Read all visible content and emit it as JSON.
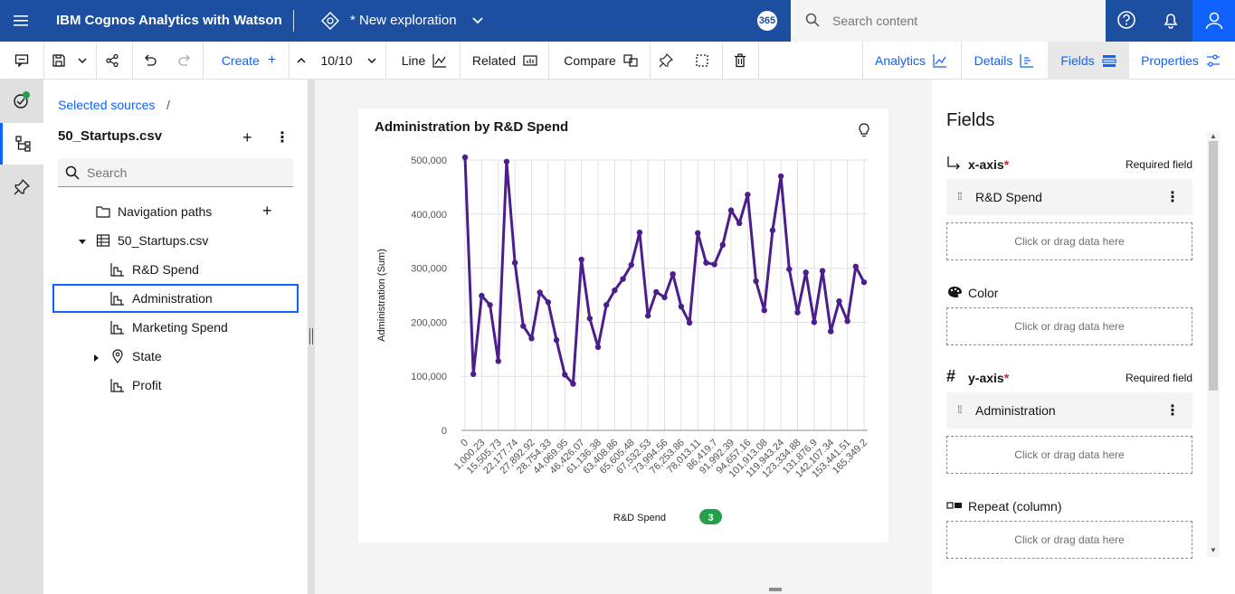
{
  "topbar": {
    "brand": "IBM Cognos Analytics with Watson",
    "exploration": "* New exploration",
    "notif_count": "365",
    "search_placeholder": "Search content"
  },
  "toolbar": {
    "create": "Create",
    "page_counter": "10/10",
    "line": "Line",
    "related": "Related",
    "compare": "Compare",
    "analytics": "Analytics",
    "details": "Details",
    "fields": "Fields",
    "properties": "Properties"
  },
  "sources": {
    "crumb": "Selected sources",
    "crumb_sep": "/",
    "file": "50_Startups.csv",
    "search_placeholder": "Search",
    "tree": [
      {
        "label": "Navigation paths"
      },
      {
        "label": "50_Startups.csv"
      },
      {
        "label": "R&D Spend"
      },
      {
        "label": "Administration"
      },
      {
        "label": "Marketing Spend"
      },
      {
        "label": "State"
      },
      {
        "label": "Profit"
      }
    ]
  },
  "card": {
    "title": "Administration by R&D Spend",
    "legend_label": "R&D Spend",
    "legend_count": "3"
  },
  "fields_panel": {
    "title": "Fields",
    "xaxis_label": "x-axis",
    "xaxis_req": "Required field",
    "xaxis_value": "R&D Spend",
    "drop_text": "Click or drag data here",
    "color_label": "Color",
    "yaxis_label": "y-axis",
    "yaxis_req": "Required field",
    "yaxis_value": "Administration",
    "repeat_label": "Repeat (column)"
  },
  "colors": {
    "brand_bar": "#1d4fa0",
    "accent": "#0f62fe",
    "series": "#4b1e8c",
    "legend_badge": "#24a148"
  },
  "chart_data": {
    "type": "line",
    "xlabel": "R&D Spend",
    "ylabel": "Administration (Sum)",
    "ylim": [
      0,
      500000
    ],
    "yticks": [
      "0",
      "100,000",
      "200,000",
      "300,000",
      "400,000",
      "500,000"
    ],
    "x_tick_labels": [
      "0",
      "1,000.23",
      "15,505.73",
      "22,177.74",
      "27,892.92",
      "28,754.33",
      "44,069.95",
      "46,426.07",
      "61,136.38",
      "63,408.86",
      "65,605.48",
      "67,532.53",
      "73,994.56",
      "76,253.86",
      "78,013.11",
      "86,419.7",
      "91,992.39",
      "94,657.16",
      "101,913.08",
      "119,943.24",
      "123,334.88",
      "131,876.9",
      "142,107.34",
      "153,441.51",
      "165,349.2"
    ],
    "values": [
      505000,
      104000,
      249000,
      232000,
      128000,
      497000,
      310000,
      193000,
      170000,
      255000,
      237000,
      167000,
      103000,
      86000,
      316000,
      207000,
      154000,
      232000,
      259000,
      280000,
      306000,
      366000,
      212000,
      256000,
      246000,
      289000,
      229000,
      199000,
      365000,
      310000,
      307000,
      343000,
      407000,
      383000,
      436000,
      276000,
      222000,
      370000,
      470000,
      298000,
      218000,
      292000,
      200000,
      295000,
      183000,
      239000,
      202000,
      303000,
      274000
    ],
    "grid": true
  }
}
